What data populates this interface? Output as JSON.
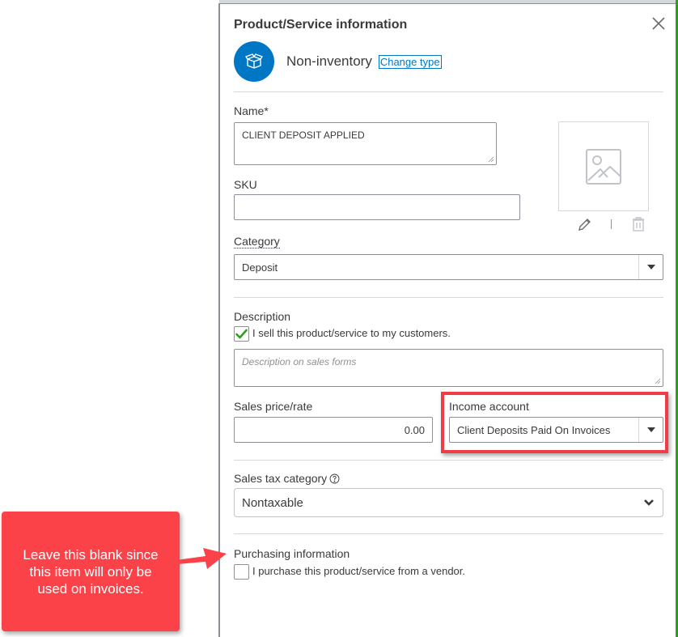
{
  "panel": {
    "title": "Product/Service information",
    "type_label": "Non-inventory",
    "change_type_link": "Change type",
    "type_icon": "box-icon",
    "close_icon": "close-icon"
  },
  "form": {
    "name": {
      "label": "Name*",
      "value": "CLIENT DEPOSIT APPLIED"
    },
    "sku": {
      "label": "SKU",
      "value": ""
    },
    "image": {
      "placeholder_icon": "image-placeholder-icon",
      "edit_icon": "pencil-icon",
      "delete_icon": "trash-icon"
    },
    "category": {
      "label": "Category",
      "value": "Deposit"
    },
    "description": {
      "label": "Description",
      "sell_checkbox_label": "I sell this product/service to my customers.",
      "sell_checked": true,
      "placeholder": "Description on sales forms"
    },
    "sales_price": {
      "label": "Sales price/rate",
      "value": "0.00"
    },
    "income_account": {
      "label": "Income account",
      "value": "Client Deposits Paid On Invoices"
    },
    "sales_tax": {
      "label": "Sales tax category",
      "help_icon": "help-circle-icon",
      "value": "Nontaxable"
    },
    "purchasing": {
      "label": "Purchasing information",
      "purchase_checkbox_label": "I purchase this product/service from a vendor.",
      "purchase_checked": false
    }
  },
  "annotation": {
    "callout_text": "Leave this blank since this item will only be used on invoices.",
    "color": "#fa4248",
    "highlight_color": "#f03c46"
  },
  "colors": {
    "brand_blue": "#0077c5",
    "check_green": "#2ca01c",
    "text": "#393a3d"
  }
}
